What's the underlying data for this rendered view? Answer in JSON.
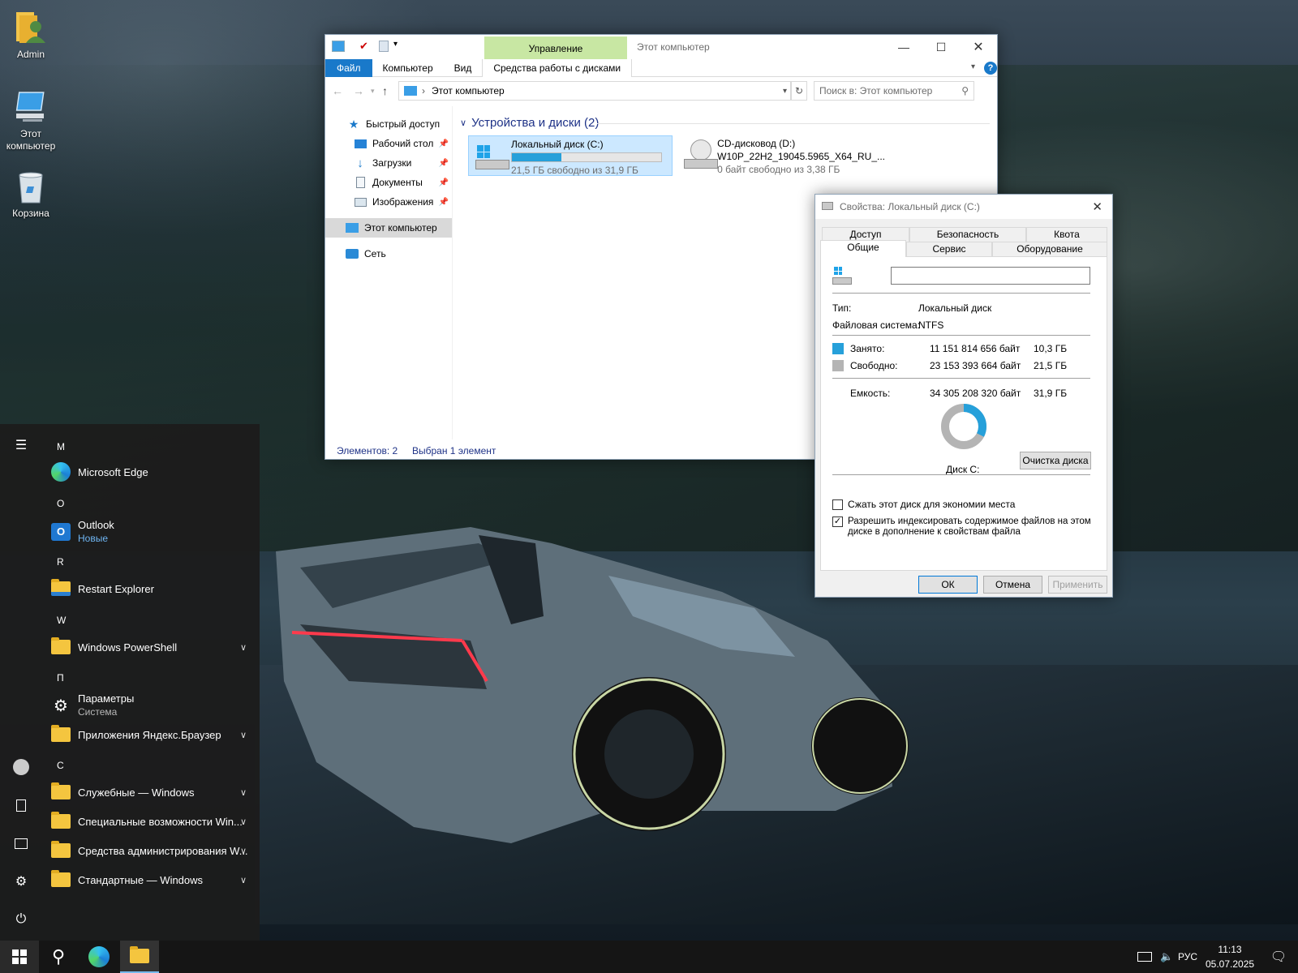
{
  "desktop": {
    "icons": [
      {
        "label": "Admin",
        "icon": "user-folder-icon"
      },
      {
        "label": "Этот компьютер",
        "icon": "computer-icon"
      },
      {
        "label": "Корзина",
        "icon": "recycle-bin-icon"
      }
    ]
  },
  "explorer": {
    "title": "Этот компьютер",
    "ribbon_context": "Управление",
    "ribbon_tabs": [
      "Файл",
      "Компьютер",
      "Вид",
      "Средства работы с дисками"
    ],
    "address": "Этот компьютер",
    "search_placeholder": "Поиск в: Этот компьютер",
    "nav": {
      "quick_access": "Быстрый доступ",
      "items": [
        "Рабочий стол",
        "Загрузки",
        "Документы",
        "Изображения"
      ],
      "this_pc": "Этот компьютер",
      "network": "Сеть"
    },
    "group_title": "Устройства и диски (2)",
    "drives": [
      {
        "name": "Локальный диск (C:)",
        "detail": "21,5 ГБ свободно из 31,9 ГБ",
        "used_fraction": 0.33
      },
      {
        "name": "CD-дисковод (D:)",
        "label": "W10P_22H2_19045.5965_X64_RU_...",
        "detail": "0 байт свободно из 3,38 ГБ"
      }
    ],
    "status_items": "Элементов: 2",
    "status_selected": "Выбран 1 элемент",
    "accent": "#26a0da"
  },
  "dialog": {
    "title": "Свойства: Локальный диск (C:)",
    "tabs_row1": [
      "Доступ",
      "Безопасность",
      "Квота"
    ],
    "tabs_row2": [
      "Общие",
      "Сервис",
      "Оборудование"
    ],
    "name_value": "",
    "type_label": "Тип:",
    "type_value": "Локальный диск",
    "fs_label": "Файловая система:",
    "fs_value": "NTFS",
    "used_label": "Занято:",
    "used_bytes": "11 151 814 656 байт",
    "used_gb": "10,3 ГБ",
    "free_label": "Свободно:",
    "free_bytes": "23 153 393 664 байт",
    "free_gb": "21,5 ГБ",
    "cap_label": "Емкость:",
    "cap_bytes": "34 305 208 320 байт",
    "cap_gb": "31,9 ГБ",
    "disk_label": "Диск С:",
    "cleanup": "Очистка диска",
    "compress": "Сжать этот диск для экономии места",
    "index_line1": "Разрешить индексировать содержимое файлов на этом",
    "index_line2": "диске в дополнение к свойствам файла",
    "compress_checked": false,
    "index_checked": true,
    "ok": "ОК",
    "cancel": "Отмена",
    "apply": "Применить",
    "used_fraction": 0.325,
    "used_color": "#26a0da",
    "free_color": "#b4b4b4"
  },
  "start_menu": {
    "letters": [
      "M",
      "O",
      "R",
      "W",
      "П",
      "С"
    ],
    "apps": [
      {
        "label": "Microsoft Edge",
        "icon": "edge-icon"
      },
      {
        "label": "Outlook",
        "sub": "Новые",
        "icon": "outlook-icon"
      },
      {
        "label": "Restart Explorer",
        "icon": "restart-explorer-icon"
      },
      {
        "label": "Windows PowerShell",
        "icon": "folder-icon"
      },
      {
        "label": "Параметры",
        "sub": "Система",
        "icon": "settings-icon"
      },
      {
        "label": "Приложения Яндекс.Браузер",
        "icon": "folder-icon"
      },
      {
        "label": "Служебные — Windows",
        "icon": "folder-icon"
      },
      {
        "label": "Специальные возможности Win...",
        "icon": "folder-icon"
      },
      {
        "label": "Средства администрирования W...",
        "icon": "folder-icon"
      },
      {
        "label": "Стандартные — Windows",
        "icon": "folder-icon"
      }
    ]
  },
  "taskbar": {
    "lang": "РУС",
    "time": "11:13",
    "date": "05.07.2025"
  }
}
